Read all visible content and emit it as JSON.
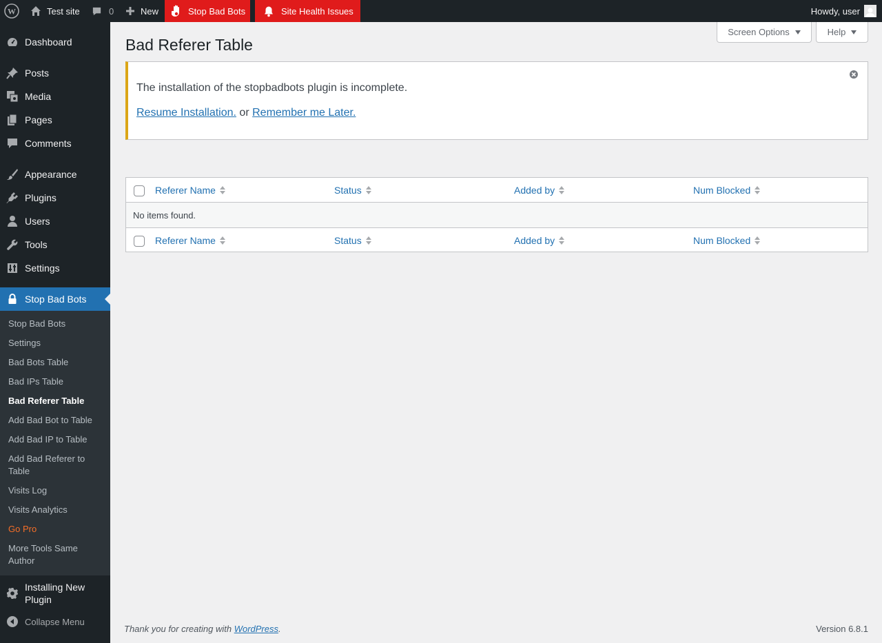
{
  "adminbar": {
    "site_name": "Test site",
    "comments_count": "0",
    "new_label": "New",
    "stopbadbots_label": "Stop Bad Bots",
    "site_health_label": "Site Health Issues",
    "howdy": "Howdy, user",
    "accent_red": "#e01b1b"
  },
  "sidebar": {
    "items": [
      {
        "label": "Dashboard",
        "icon": "dashboard-icon"
      },
      {
        "label": "Posts",
        "icon": "pin-icon"
      },
      {
        "label": "Media",
        "icon": "media-icon"
      },
      {
        "label": "Pages",
        "icon": "pages-icon"
      },
      {
        "label": "Comments",
        "icon": "comment-icon"
      },
      {
        "label": "Appearance",
        "icon": "brush-icon"
      },
      {
        "label": "Plugins",
        "icon": "plug-icon"
      },
      {
        "label": "Users",
        "icon": "user-icon"
      },
      {
        "label": "Tools",
        "icon": "wrench-icon"
      },
      {
        "label": "Settings",
        "icon": "settings-icon"
      },
      {
        "label": "Stop Bad Bots",
        "icon": "lock-icon"
      },
      {
        "label": "Installing New Plugin",
        "icon": "gear-icon"
      },
      {
        "label": "Collapse Menu",
        "icon": "collapse-icon"
      }
    ],
    "submenu": [
      "Stop Bad Bots",
      "Settings",
      "Bad Bots Table",
      "Bad IPs Table",
      "Bad Referer Table",
      "Add Bad Bot to Table",
      "Add Bad IP to Table",
      "Add Bad Referer to Table",
      "Visits Log",
      "Visits Analytics",
      "Go Pro",
      "More Tools Same Author"
    ],
    "accent_blue": "#2271b1"
  },
  "screen_options": "Screen Options",
  "help": "Help",
  "page_title": "Bad Referer Table",
  "notice": {
    "text": "The installation of the stopbadbots plugin is incomplete.",
    "resume_link": "Resume Installation.",
    "or": "or",
    "later_link": "Remember me Later.",
    "border_color": "#dba617"
  },
  "table": {
    "columns": [
      "Referer Name",
      "Status",
      "Added by",
      "Num Blocked"
    ],
    "empty_message": "No items found."
  },
  "footer": {
    "thanks": "Thank you for creating with",
    "wp_link": "WordPress",
    "period": ".",
    "version": "Version 6.8.1"
  }
}
